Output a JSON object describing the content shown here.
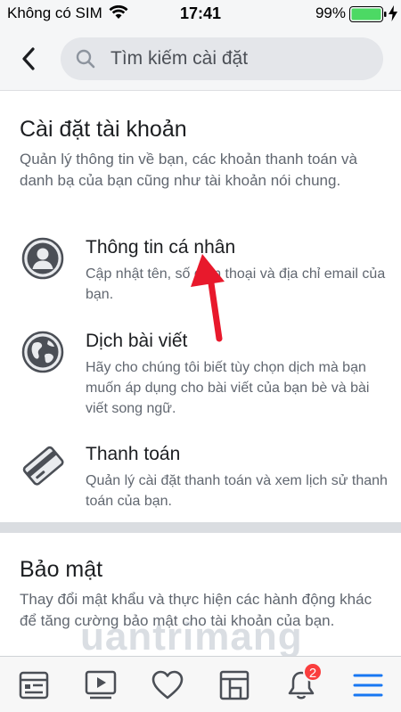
{
  "status_bar": {
    "carrier": "Không có SIM",
    "time": "17:41",
    "battery_percent": "99%"
  },
  "search": {
    "placeholder": "Tìm kiếm cài đặt"
  },
  "account_section": {
    "title": "Cài đặt tài khoản",
    "description": "Quản lý thông tin về bạn, các khoản thanh toán và danh bạ của bạn cũng như tài khoản nói chung.",
    "items": [
      {
        "title": "Thông tin cá nhân",
        "description": "Cập nhật tên, số điện thoại và địa chỉ email của bạn.",
        "icon": "person-icon"
      },
      {
        "title": "Dịch bài viết",
        "description": "Hãy cho chúng tôi biết tùy chọn dịch mà bạn muốn áp dụng cho bài viết của bạn bè và bài viết song ngữ.",
        "icon": "globe-icon"
      },
      {
        "title": "Thanh toán",
        "description": "Quản lý cài đặt thanh toán và xem lịch sử thanh toán của bạn.",
        "icon": "credit-card-icon"
      }
    ]
  },
  "security_section": {
    "title": "Bảo mật",
    "description": "Thay đổi mật khẩu và thực hiện các hành động khác để tăng cường bảo mật cho tài khoản của bạn."
  },
  "watermark": "uantrimang",
  "tab_bar": {
    "notifications_badge": "2",
    "tabs": [
      "news-feed-icon",
      "watch-icon",
      "heart-icon",
      "marketplace-icon",
      "bell-icon",
      "menu-icon"
    ]
  },
  "colors": {
    "accent": "#1877f2",
    "arrow": "#e8192c",
    "badge": "#fa3e3e",
    "battery": "#4cd964"
  }
}
